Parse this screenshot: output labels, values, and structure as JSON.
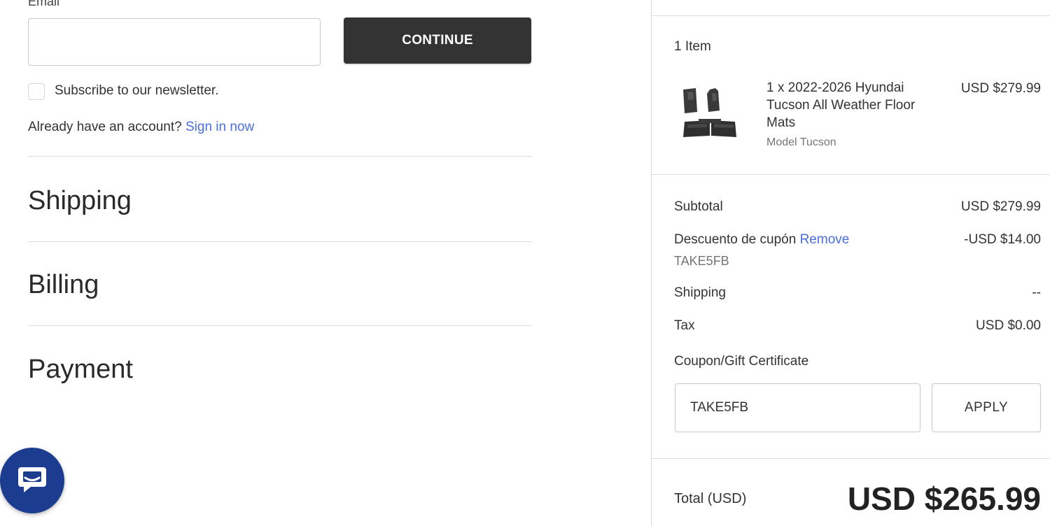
{
  "contact": {
    "email_label": "Email",
    "email_value": "",
    "continue_label": "CONTINUE",
    "newsletter_label": "Subscribe to our newsletter.",
    "account_prompt": "Already have an account?",
    "sign_in_link": "Sign in now"
  },
  "sections": {
    "shipping": "Shipping",
    "billing": "Billing",
    "payment": "Payment"
  },
  "summary": {
    "item_count": "1 Item",
    "product": {
      "name_line1": "1 x 2022-2026 Hyundai",
      "name_line2": "Tucson All Weather Floor",
      "name_line3": "Mats",
      "option": "Model Tucson",
      "price": "USD $279.99",
      "thumbnail_icon": "floor-mats-icon"
    },
    "subtotal_label": "Subtotal",
    "subtotal_value": "USD $279.99",
    "discount_label": "Descuento de cupón",
    "discount_remove": "Remove",
    "discount_code": "TAKE5FB",
    "discount_value": "-USD $14.00",
    "shipping_label": "Shipping",
    "shipping_value": "--",
    "tax_label": "Tax",
    "tax_value": "USD $0.00",
    "coupon_label": "Coupon/Gift Certificate",
    "coupon_value": "TAKE5FB",
    "apply_label": "APPLY",
    "total_label": "Total (USD)",
    "total_value": "USD $265.99"
  },
  "colors": {
    "continue_bg": "#333333",
    "link": "#4a6ee0",
    "chat_bubble": "#1c3d8f"
  },
  "chat": {
    "icon": "chat-icon"
  }
}
